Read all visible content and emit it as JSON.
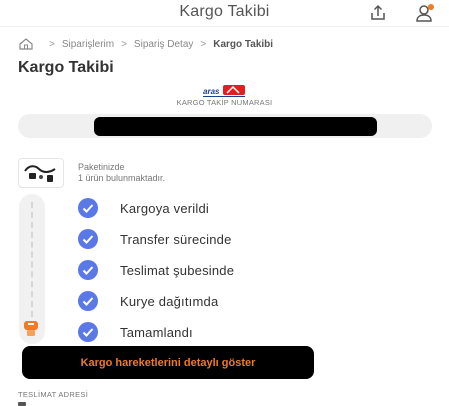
{
  "header": {
    "title": "Kargo Takibi"
  },
  "breadcrumb": {
    "items": [
      "Siparişlerim",
      "Sipariş Detay"
    ],
    "current": "Kargo Takibi"
  },
  "page": {
    "title": "Kargo Takibi"
  },
  "tracking": {
    "label": "KARGO TAKİP NUMARASI",
    "carrier_icon": "aras-kargo-logo"
  },
  "package": {
    "line1": "Paketinizde",
    "line2": "1 ürün bulunmaktadır."
  },
  "steps": [
    {
      "label": "Kargoya verildi",
      "done": true
    },
    {
      "label": "Transfer sürecinde",
      "done": true
    },
    {
      "label": "Teslimat şubesinde",
      "done": true
    },
    {
      "label": "Kurye dağıtımda",
      "done": true
    },
    {
      "label": "Tamamlandı",
      "done": true
    }
  ],
  "details_button": {
    "label": "Kargo hareketlerini detaylı göster"
  },
  "address": {
    "title": "TESLİMAT ADRESİ"
  },
  "colors": {
    "accent": "#f07a25",
    "check": "#5b79e6",
    "carrier_red": "#e02020"
  }
}
